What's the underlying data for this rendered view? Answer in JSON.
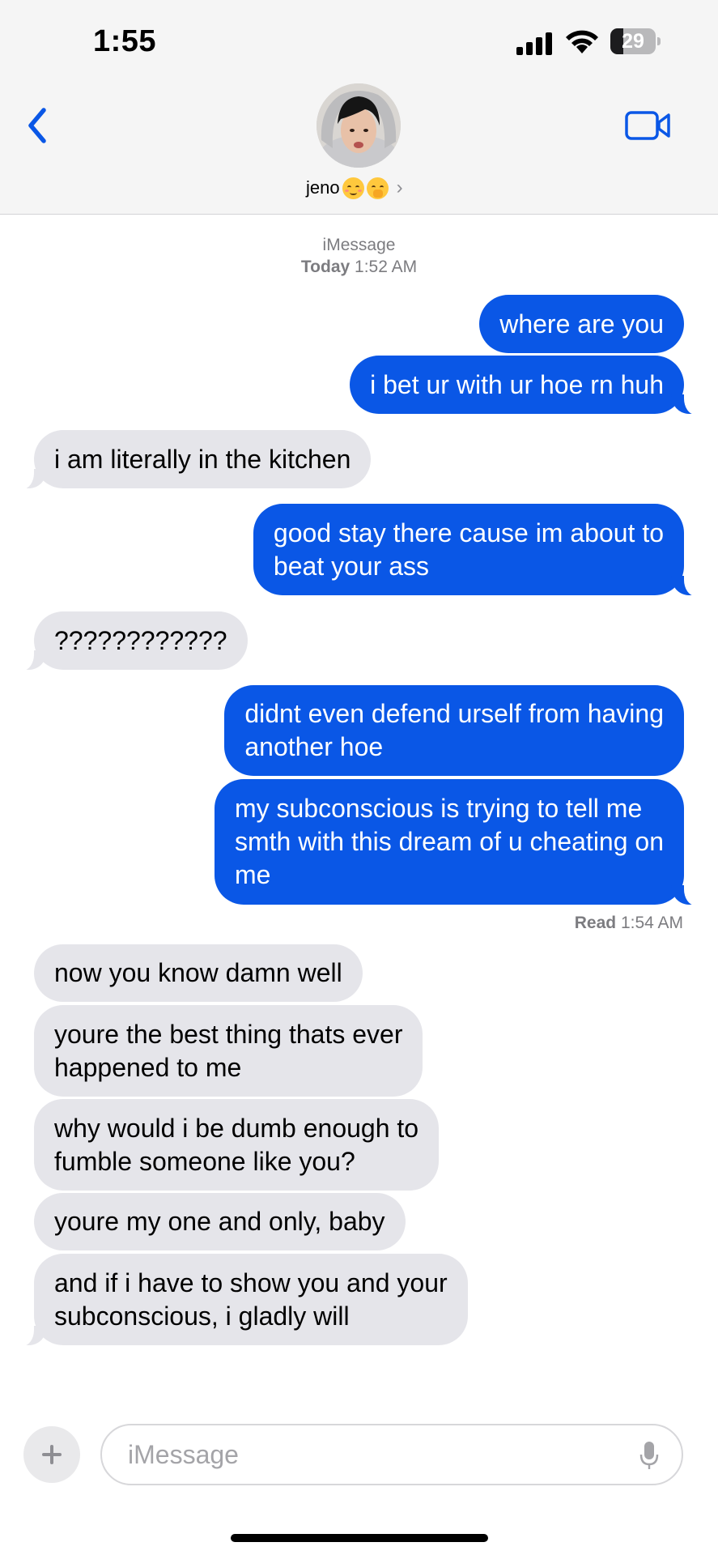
{
  "status_bar": {
    "time": "1:55",
    "battery": "29",
    "battery_level": 0.29
  },
  "header": {
    "contact_name": "jeno",
    "contact_emojis": [
      "relieved-face",
      "face-with-hand-over-mouth"
    ],
    "icons": {
      "back": "chevron-left-icon",
      "video": "video-camera-icon",
      "chevron": "chevron-right-icon"
    }
  },
  "conversation": {
    "service": "iMessage",
    "timestamp_day": "Today",
    "timestamp_time": "1:52 AM",
    "read_label": "Read",
    "read_time": "1:54 AM",
    "messages": [
      {
        "direction": "outgoing",
        "text": "where are you"
      },
      {
        "direction": "outgoing",
        "text": "i bet ur with ur hoe rn huh"
      },
      {
        "direction": "incoming",
        "text": "i am literally in the kitchen"
      },
      {
        "direction": "outgoing",
        "text": "good stay there cause im about to\nbeat your ass"
      },
      {
        "direction": "incoming",
        "text": "????????????"
      },
      {
        "direction": "outgoing",
        "text": "didnt even defend urself from having\nanother hoe"
      },
      {
        "direction": "outgoing",
        "text": "my subconscious is trying to tell me\nsmth with this dream of u cheating on\nme"
      },
      {
        "direction": "incoming",
        "text": "now you know damn well"
      },
      {
        "direction": "incoming",
        "text": "youre the best thing thats ever\nhappened to me"
      },
      {
        "direction": "incoming",
        "text": "why would i be dumb enough to\nfumble someone like you?"
      },
      {
        "direction": "incoming",
        "text": "youre my one and only, baby"
      },
      {
        "direction": "incoming",
        "text": "and if i have to show you and your\nsubconscious, i gladly will"
      }
    ]
  },
  "composer": {
    "placeholder": "iMessage",
    "value": "",
    "icons": {
      "plus": "plus-icon",
      "mic": "microphone-icon"
    }
  },
  "colors": {
    "outgoing_bubble": "#0a57e6",
    "incoming_bubble": "#e5e5ea",
    "accent": "#0a57e6",
    "header_bg": "#f5f5f5"
  }
}
